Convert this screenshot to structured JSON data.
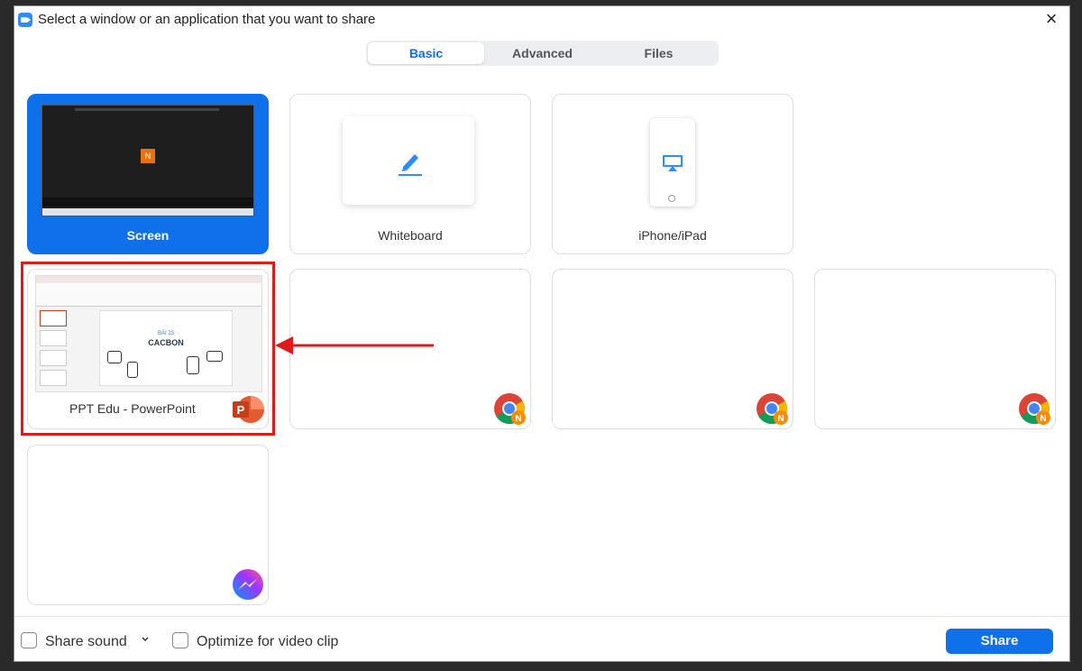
{
  "window": {
    "title": "Select a window or an application that you want to share"
  },
  "tabs": [
    {
      "label": "Basic",
      "active": true
    },
    {
      "label": "Advanced",
      "active": false
    },
    {
      "label": "Files",
      "active": false
    }
  ],
  "cards": {
    "screen": {
      "label": "Screen",
      "selected": true,
      "avatar_letter": "N"
    },
    "whiteboard": {
      "label": "Whiteboard"
    },
    "iphone": {
      "label": "iPhone/iPad"
    },
    "ppt": {
      "label": "PPT Edu - PowerPoint",
      "slide_title": "CACBON",
      "slide_subtitle": "BÀI 23",
      "app_icon": "powerpoint-icon",
      "app_icon_letter": "P"
    },
    "chrome_windows": [
      {
        "app_icon": "chrome-icon",
        "badge_letter": "N"
      },
      {
        "app_icon": "chrome-icon",
        "badge_letter": "N"
      },
      {
        "app_icon": "chrome-icon",
        "badge_letter": "N"
      }
    ],
    "messenger": {
      "app_icon": "messenger-icon"
    }
  },
  "footer": {
    "share_sound_label": "Share sound",
    "optimize_label": "Optimize for video clip",
    "share_button": "Share"
  },
  "colors": {
    "accent": "#0e71eb",
    "highlight": "#e01919",
    "powerpoint": "#c43e1c"
  }
}
